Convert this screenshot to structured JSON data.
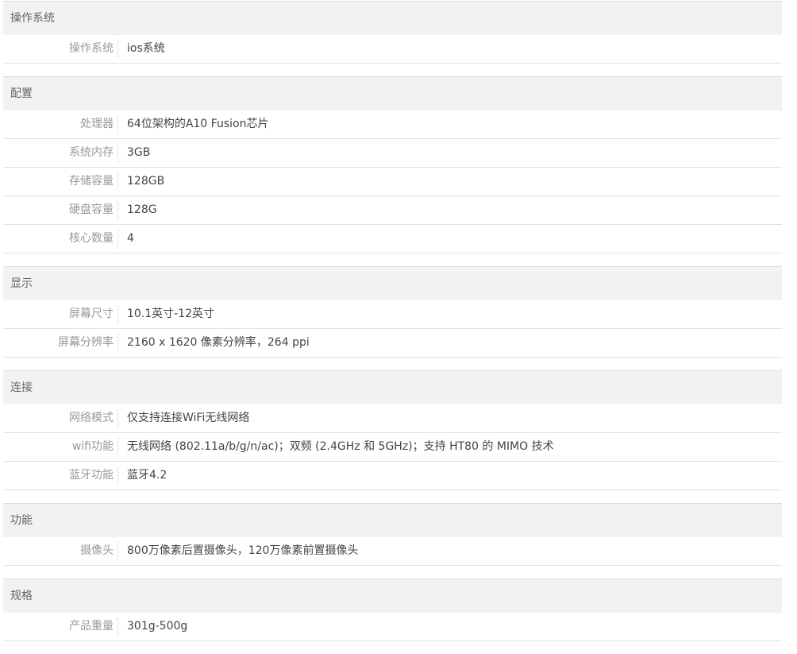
{
  "sections": [
    {
      "title": "操作系统",
      "rows": [
        {
          "label": "操作系统",
          "value": "ios系统"
        }
      ]
    },
    {
      "title": "配置",
      "rows": [
        {
          "label": "处理器",
          "value": "64位架构的A10 Fusion芯片"
        },
        {
          "label": "系统内存",
          "value": "3GB"
        },
        {
          "label": "存储容量",
          "value": "128GB"
        },
        {
          "label": "硬盘容量",
          "value": "128G"
        },
        {
          "label": "核心数量",
          "value": "4"
        }
      ]
    },
    {
      "title": "显示",
      "rows": [
        {
          "label": "屏幕尺寸",
          "value": "10.1英寸-12英寸"
        },
        {
          "label": "屏幕分辨率",
          "value": "2160 x 1620 像素分辨率，264 ppi"
        }
      ]
    },
    {
      "title": "连接",
      "rows": [
        {
          "label": "网络模式",
          "value": "仅支持连接WiFi无线网络"
        },
        {
          "label": "wifi功能",
          "value": "无线网络 (802.11a/b/g/n/ac)；双频 (2.4GHz 和 5GHz)；支持 HT80 的 MIMO 技术"
        },
        {
          "label": "蓝牙功能",
          "value": "蓝牙4.2"
        }
      ]
    },
    {
      "title": "功能",
      "rows": [
        {
          "label": "摄像头",
          "value": "800万像素后置摄像头，120万像素前置摄像头"
        }
      ]
    },
    {
      "title": "规格",
      "rows": [
        {
          "label": "产品重量",
          "value": "301g-500g"
        }
      ]
    }
  ]
}
